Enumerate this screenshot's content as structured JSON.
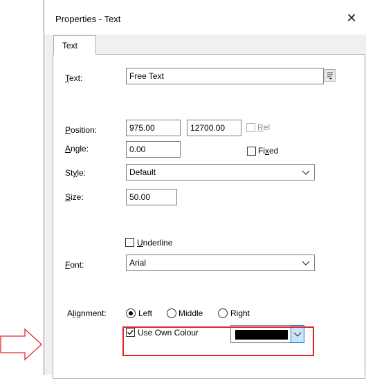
{
  "dialog": {
    "title": "Properties - Text",
    "close_glyph": "✕"
  },
  "tab": {
    "label": "Text"
  },
  "text_field": {
    "label_accel": "T",
    "label_rest": "ext:",
    "value": "Free Text"
  },
  "position": {
    "label_accel": "P",
    "label_rest": "osition:",
    "x_value": "975.00",
    "y_value": "12700.00",
    "rel_accel": "R",
    "rel_rest": "el"
  },
  "angle": {
    "label_accel": "A",
    "label_rest": "ngle:",
    "value": "0.00",
    "fixed_pre": "Fi",
    "fixed_accel": "x",
    "fixed_post": "ed"
  },
  "style": {
    "label_pre": "St",
    "label_accel": "y",
    "label_post": "le:",
    "value": "Default"
  },
  "size": {
    "label_accel": "S",
    "label_rest": "ize:",
    "value": "50.00"
  },
  "underline": {
    "accel": "U",
    "rest": "nderline"
  },
  "font": {
    "label_accel": "F",
    "label_rest": "ont:",
    "value": "Arial"
  },
  "alignment": {
    "label_pre": "A",
    "label_accel": "l",
    "label_post": "ignment:",
    "options": [
      "Left",
      "Middle",
      "Right"
    ],
    "selected": "Left"
  },
  "own_colour": {
    "label": "Use Own Colour",
    "checked": true,
    "colour": "#000000"
  },
  "colors": {
    "highlight": "#e4232b",
    "arrow": "#e4232b"
  }
}
